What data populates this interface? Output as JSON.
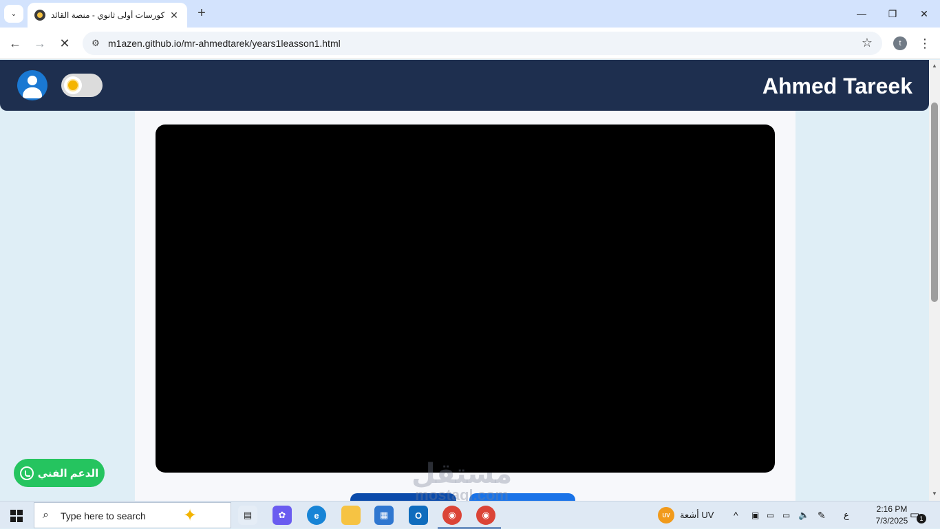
{
  "browser": {
    "tab_title": "كورسات أولى ثانوي - منصة القائد",
    "tab_menu_glyph": "⌄",
    "tab_close_glyph": "✕",
    "new_tab_glyph": "+",
    "url": "m1azen.github.io/mr-ahmedtarek/years1leasson1.html",
    "profile_initial": "t",
    "window_controls": {
      "minimize": "—",
      "restore": "❐",
      "close": "✕"
    },
    "nav_glyphs": {
      "back": "←",
      "forward": "→",
      "stop": "✕",
      "star": "☆",
      "menu": "⋮",
      "site_info": "⚙"
    }
  },
  "site": {
    "brand": "Ahmed Tareek",
    "support_label": "الدعم الفني",
    "watermark_ar": "مستقل",
    "watermark_en": "mostaql.com",
    "colors": {
      "header": "#1e2f4f",
      "page_bg": "#dfeef6",
      "support": "#25c45f",
      "button_dark": "#0b4bab",
      "button_light": "#1a73e8"
    },
    "theme_toggle_state": "light"
  },
  "taskbar": {
    "search_placeholder": "Type here to search",
    "weather_icon_text": "UV",
    "weather_text": "أشعة UV",
    "language": "ع",
    "time": "2:16 PM",
    "date": "7/3/2025",
    "notification_count": "1",
    "tray_glyphs": {
      "chevron": "^",
      "speaker": "🔈",
      "network": "▭",
      "pen": "✎"
    },
    "apps": [
      "task-view",
      "copilot",
      "edge",
      "file-explorer",
      "microsoft-store",
      "outlook",
      "chrome",
      "chrome"
    ]
  }
}
